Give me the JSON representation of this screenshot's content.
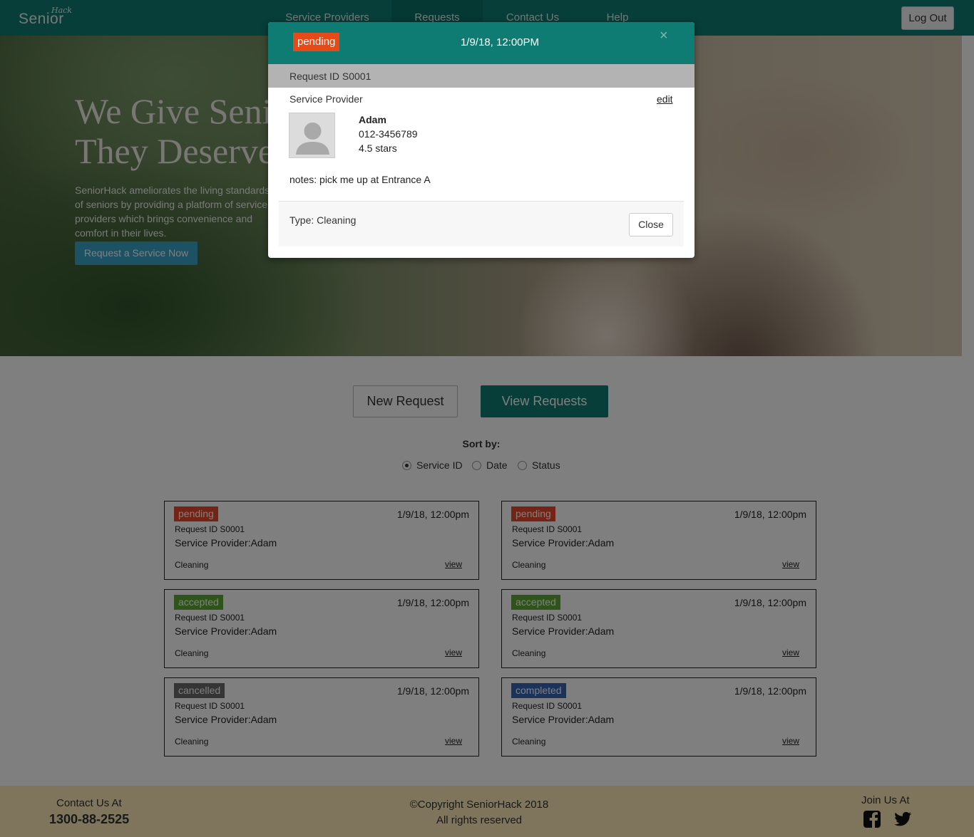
{
  "nav": {
    "brand_main": "Senior",
    "brand_sup": "Hack",
    "items": [
      {
        "label": "Service Providers"
      },
      {
        "label": "Requests"
      },
      {
        "label": "Contact Us"
      },
      {
        "label": "Help"
      }
    ],
    "active_item": "Requests",
    "logout_label": "Log Out"
  },
  "hero": {
    "title": "We Give Seniors\nThey Deserve",
    "text": "SeniorHack ameliorates the living standards of seniors by providing a platform of service providers which brings convenience and comfort in their lives.",
    "button": "Request a Service Now"
  },
  "actions": {
    "new_request": "New Request",
    "view_requests": "View Requests"
  },
  "sort": {
    "label": "Sort by:",
    "options": [
      {
        "label": "Service ID",
        "checked": true
      },
      {
        "label": "Date",
        "checked": false
      },
      {
        "label": "Status",
        "checked": false
      }
    ]
  },
  "cards": [
    {
      "status": "pending",
      "time": "1/9/18, 12:00pm",
      "request_id": "Request ID S0001",
      "provider": "Service Provider:Adam",
      "type": "Cleaning",
      "view": "view"
    },
    {
      "status": "pending",
      "time": "1/9/18, 12:00pm",
      "request_id": "Request ID S0001",
      "provider": "Service Provider:Adam",
      "type": "Cleaning",
      "view": "view"
    },
    {
      "status": "accepted",
      "time": "1/9/18, 12:00pm",
      "request_id": "Request ID S0001",
      "provider": "Service Provider:Adam",
      "type": "Cleaning",
      "view": "view"
    },
    {
      "status": "accepted",
      "time": "1/9/18, 12:00pm",
      "request_id": "Request ID S0001",
      "provider": "Service Provider:Adam",
      "type": "Cleaning",
      "view": "view"
    },
    {
      "status": "cancelled",
      "time": "1/9/18, 12:00pm",
      "request_id": "Request ID S0001",
      "provider": "Service Provider:Adam",
      "type": "Cleaning",
      "view": "view"
    },
    {
      "status": "completed",
      "time": "1/9/18, 12:00pm",
      "request_id": "Request ID S0001",
      "provider": "Service Provider:Adam",
      "type": "Cleaning",
      "view": "view"
    }
  ],
  "status_colors": {
    "pending": "#e8492a",
    "accepted": "#5ea832",
    "cancelled": "#6b6b6b",
    "completed": "#3665b5"
  },
  "footer": {
    "contact_label": "Contact Us At",
    "phone": "1300-88-2525",
    "copyright": "©Copyright SeniorHack 2018",
    "rights": "All rights reserved",
    "join_label": "Join Us At",
    "social_icons": [
      "facebook-icon",
      "twitter-icon"
    ]
  },
  "modal": {
    "status": "pending",
    "datetime": "1/9/18, 12:00PM",
    "close_icon": "×",
    "request_id": "Request ID S0001",
    "sp_label": "Service Provider",
    "edit": "edit",
    "provider": {
      "name": "Adam",
      "phone": "012-3456789",
      "rating": "4.5 stars"
    },
    "notes": "notes: pick me up at Entrance A",
    "type": "Type: Cleaning",
    "close_button": "Close"
  },
  "colors": {
    "brand": "#0e7c72",
    "footer": "#ffe9b8"
  }
}
